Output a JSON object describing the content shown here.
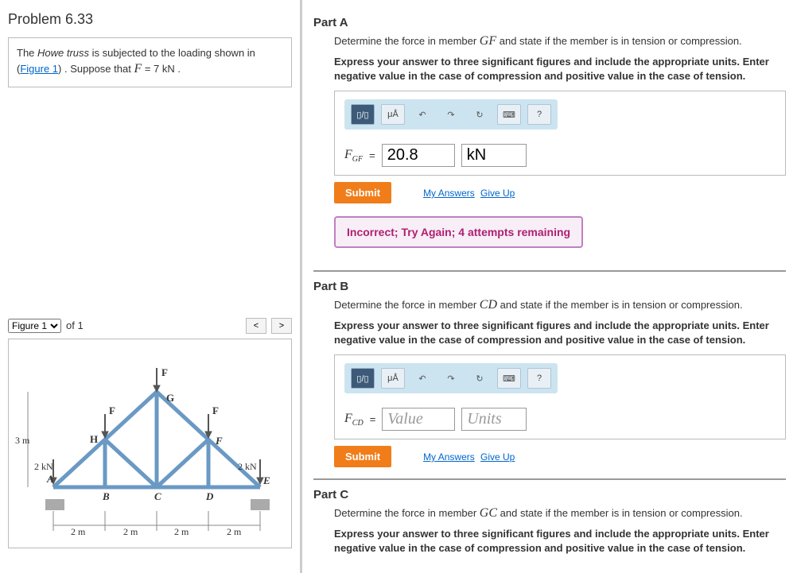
{
  "problem": {
    "title": "Problem 6.33",
    "text_prefix": "The ",
    "text_em": "Howe truss",
    "text_body": " is subjected to the loading shown in (",
    "figure_link": "Figure 1",
    "text_suffix": ") . Suppose that ",
    "var": "F",
    "eq": " = 7 kN ."
  },
  "figure": {
    "label": "Figure 1",
    "of": "of 1",
    "nav_prev": "<",
    "nav_next": ">",
    "F": "F",
    "G": "G",
    "H": "H",
    "E": "E",
    "A": "A",
    "B": "B",
    "C": "C",
    "D": "D",
    "load2kn": "2 kN",
    "height": "3 m",
    "span": "2 m"
  },
  "parts": [
    {
      "id": "A",
      "title": "Part A",
      "prompt_pre": "Determine the force in member ",
      "member": "GF",
      "prompt_post": " and state if the member is in tension or compression.",
      "instr": "Express your answer to three significant figures and include the appropriate units. Enter negative value in the case of compression and positive value in the case of tension.",
      "varlabel": "F",
      "sub": "GF",
      "eq": "=",
      "value": "20.8",
      "unit": "kN",
      "has_value": true,
      "feedback": "Incorrect; Try Again; 4 attempts remaining"
    },
    {
      "id": "B",
      "title": "Part B",
      "prompt_pre": "Determine the force in member ",
      "member": "CD",
      "prompt_post": " and state if the member is in tension or compression.",
      "instr": "Express your answer to three significant figures and include the appropriate units. Enter negative value in the case of compression and positive value in the case of tension.",
      "varlabel": "F",
      "sub": "CD",
      "eq": "=",
      "value": "Value",
      "unit": "Units",
      "has_value": false,
      "feedback": null
    },
    {
      "id": "C",
      "title": "Part C",
      "prompt_pre": "Determine the force in member ",
      "member": "GC",
      "prompt_post": " and state if the member is in tension or compression.",
      "instr": "Express your answer to three significant figures and include the appropriate units. Enter negative value in the case of compression and positive value in the case of tension."
    }
  ],
  "tb": {
    "frac": "▯/▯",
    "units": "μÅ",
    "undo": "↶",
    "redo": "↷",
    "reset": "↻",
    "kbd": "⌨",
    "help": "?"
  },
  "submit": "Submit",
  "my_answers": "My Answers",
  "give_up": "Give Up"
}
